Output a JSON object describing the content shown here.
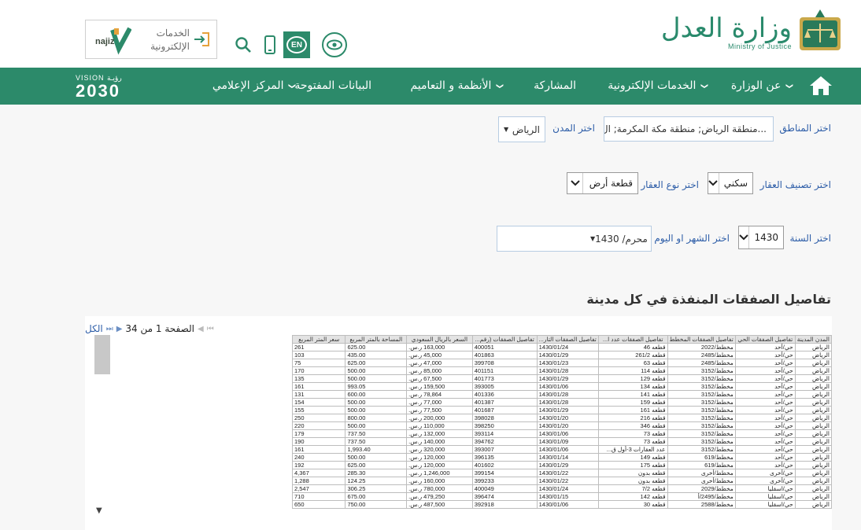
{
  "header": {
    "ministry_name": "وزارة العدل",
    "ministry_name_en": "Ministry of Justice",
    "lang_button": "EN",
    "najiz_services": "الخدمات الإلكترونية",
    "najiz_brand": "najiz"
  },
  "nav": {
    "items": [
      {
        "label": "عن الوزارة",
        "chevron": true
      },
      {
        "label": "الخدمات الإلكترونية",
        "chevron": true
      },
      {
        "label": "المشاركة",
        "chevron": false
      },
      {
        "label": "الأنظمة و التعاميم",
        "chevron": true
      },
      {
        "label": "البيانات المفتوحة",
        "chevron": false
      },
      {
        "label": "المركز الإعلامي",
        "chevron": true
      }
    ],
    "vision_top": "VISION رؤيـة",
    "vision_year": "2030"
  },
  "filters": {
    "regions_label": "اختر المناطق",
    "regions_value": "منطقة الرياض; منطقة مكة المكرمة; ال...",
    "cities_label": "اختر المدن",
    "cities_value": "الرياض",
    "classification_label": "اختر تصنيف العقار",
    "classification_value": "سكني",
    "type_label": "اختر نوع العقار",
    "type_value": "قطعة أرض",
    "year_label": "اختر السنة",
    "year_value": "1430",
    "month_label": "اختر الشهر او اليوم",
    "month_value": "محرم/ 1430"
  },
  "section_title": "تفاصيل الصفقات المنفذة في كل مدينة",
  "report": {
    "all_label": "الكل",
    "page_label": "الصفحة 1 من 34",
    "columns": [
      "المدن المدينة",
      "تفاصيل الصفقات الحي",
      "تفاصيل الصفقات المخطط",
      "تفاصيل الصفقات عدد ا...",
      "تفاصيل الصفقات التار...",
      "تفاصيل الصفقات (رقم...",
      "السعر بالريال السعودي",
      "المساحة بالمتر المربع",
      "سعر المتر المربع"
    ],
    "rows": [
      [
        "الرياض",
        "حي/أحد",
        "مخطط/2022",
        "قطعه 46",
        "1430/01/24",
        "400051",
        "163,000 ر.س.",
        "625.00",
        "261"
      ],
      [
        "الرياض",
        "حي/أحد",
        "مخطط/2485",
        "قطعه 261/2",
        "1430/01/29",
        "401863",
        "45,000 ر.س.",
        "435.00",
        "103"
      ],
      [
        "الرياض",
        "حي/أحد",
        "مخطط/2485",
        "قطعه 63",
        "1430/01/23",
        "399708",
        "47,000 ر.س.",
        "625.00",
        "75"
      ],
      [
        "الرياض",
        "حي/أحد",
        "مخطط/3152",
        "قطعه 114",
        "1430/01/28",
        "401151",
        "85,000 ر.س.",
        "500.00",
        "170"
      ],
      [
        "الرياض",
        "حي/أحد",
        "مخطط/3152",
        "قطعه 129",
        "1430/01/29",
        "401773",
        "67,500 ر.س.",
        "500.00",
        "135"
      ],
      [
        "الرياض",
        "حي/أحد",
        "مخطط/3152",
        "قطعه 134",
        "1430/01/06",
        "393005",
        "159,500 ر.س.",
        "993.05",
        "161"
      ],
      [
        "الرياض",
        "حي/أحد",
        "مخطط/3152",
        "قطعه 141",
        "1430/01/28",
        "401336",
        "78,864 ر.س.",
        "600.00",
        "131"
      ],
      [
        "الرياض",
        "حي/أحد",
        "مخطط/3152",
        "قطعه 159",
        "1430/01/28",
        "401387",
        "77,000 ر.س.",
        "500.00",
        "154"
      ],
      [
        "الرياض",
        "حي/أحد",
        "مخطط/3152",
        "قطعه 161",
        "1430/01/29",
        "401687",
        "77,500 ر.س.",
        "500.00",
        "155"
      ],
      [
        "الرياض",
        "حي/أحد",
        "مخطط/3152",
        "قطعه 216",
        "1430/01/20",
        "398028",
        "200,000 ر.س.",
        "800.00",
        "250"
      ],
      [
        "الرياض",
        "حي/أحد",
        "مخطط/3152",
        "قطعه 346",
        "1430/01/20",
        "398250",
        "110,000 ر.س.",
        "500.00",
        "220"
      ],
      [
        "الرياض",
        "حي/أحد",
        "مخطط/3152",
        "قطعه 73",
        "1430/01/06",
        "393114",
        "132,000 ر.س.",
        "737.50",
        "179"
      ],
      [
        "الرياض",
        "حي/أحد",
        "مخطط/3152",
        "قطعه 73",
        "1430/01/09",
        "394762",
        "140,000 ر.س.",
        "737.50",
        "190"
      ],
      [
        "الرياض",
        "حي/أحد",
        "مخطط/3152",
        "عدد العقارات 3-أول ق...",
        "1430/01/06",
        "393007",
        "320,000 ر.س.",
        "1,993.40",
        "161"
      ],
      [
        "الرياض",
        "حي/أحد",
        "مخطط/619",
        "قطعه 149",
        "1430/01/14",
        "396135",
        "120,000 ر.س.",
        "500.00",
        "240"
      ],
      [
        "الرياض",
        "حي/أحد",
        "مخطط/619",
        "قطعه 175",
        "1430/01/29",
        "401602",
        "120,000 ر.س.",
        "625.00",
        "192"
      ],
      [
        "الرياض",
        "حي/أخرى",
        "مخطط/أخرى",
        "قطعه بدون",
        "1430/01/22",
        "399154",
        "1,246,000 ر.س.",
        "285.30",
        "4,367"
      ],
      [
        "الرياض",
        "حي/أخرى",
        "مخطط/أخرى",
        "قطعه بدون",
        "1430/01/22",
        "399233",
        "160,000 ر.س.",
        "124.25",
        "1,288"
      ],
      [
        "الرياض",
        "حي/اسقليا",
        "مخطط/2029",
        "قطعه 7/2",
        "1430/01/24",
        "400049",
        "780,000 ر.س.",
        "306.25",
        "2,547"
      ],
      [
        "الرياض",
        "حي/اسقليا",
        "مخطط/2495/أ",
        "قطعه 142",
        "1430/01/15",
        "396474",
        "479,250 ر.س.",
        "675.00",
        "710"
      ],
      [
        "الرياض",
        "حي/اسقليا",
        "مخطط/2588",
        "قطعه 30",
        "1430/01/06",
        "392918",
        "487,500 ر.س.",
        "750.00",
        "650"
      ]
    ]
  },
  "colors": {
    "nav_green": "#2c8a6a",
    "label_blue": "#2e5ea8"
  }
}
